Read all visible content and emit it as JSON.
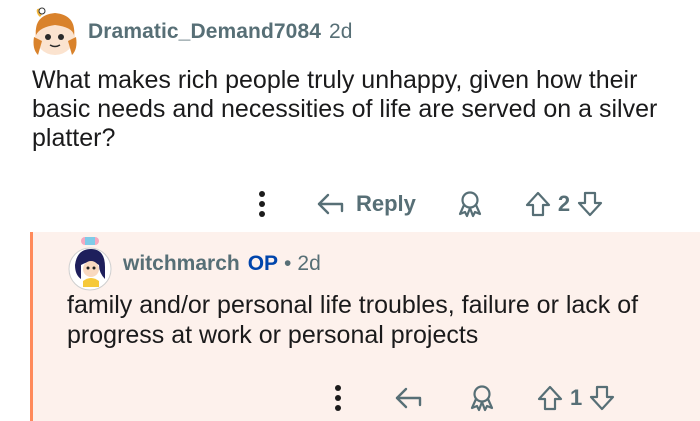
{
  "parent_comment": {
    "author": "Dramatic_Demand7084",
    "age": "2d",
    "body": "What makes rich people truly unhappy, given how their basic needs and necessities of life are served on a silver platter?",
    "actions": {
      "reply_label": "Reply",
      "vote_count": "2"
    }
  },
  "reply_comment": {
    "author": "witchmarch",
    "op_tag": "OP",
    "separator": "•",
    "age": "2d",
    "body": "family and/or personal life troubles, failure or lack of progress at work or personal projects",
    "actions": {
      "vote_count": "1"
    }
  },
  "colors": {
    "meta_text": "#576f76",
    "op_blue": "#0045ac",
    "reply_bg": "#fdf1ec",
    "thread_line": "#ff8a5a"
  },
  "icons": [
    "more-options-icon",
    "reply-arrow-icon",
    "award-icon",
    "upvote-icon",
    "downvote-icon"
  ]
}
